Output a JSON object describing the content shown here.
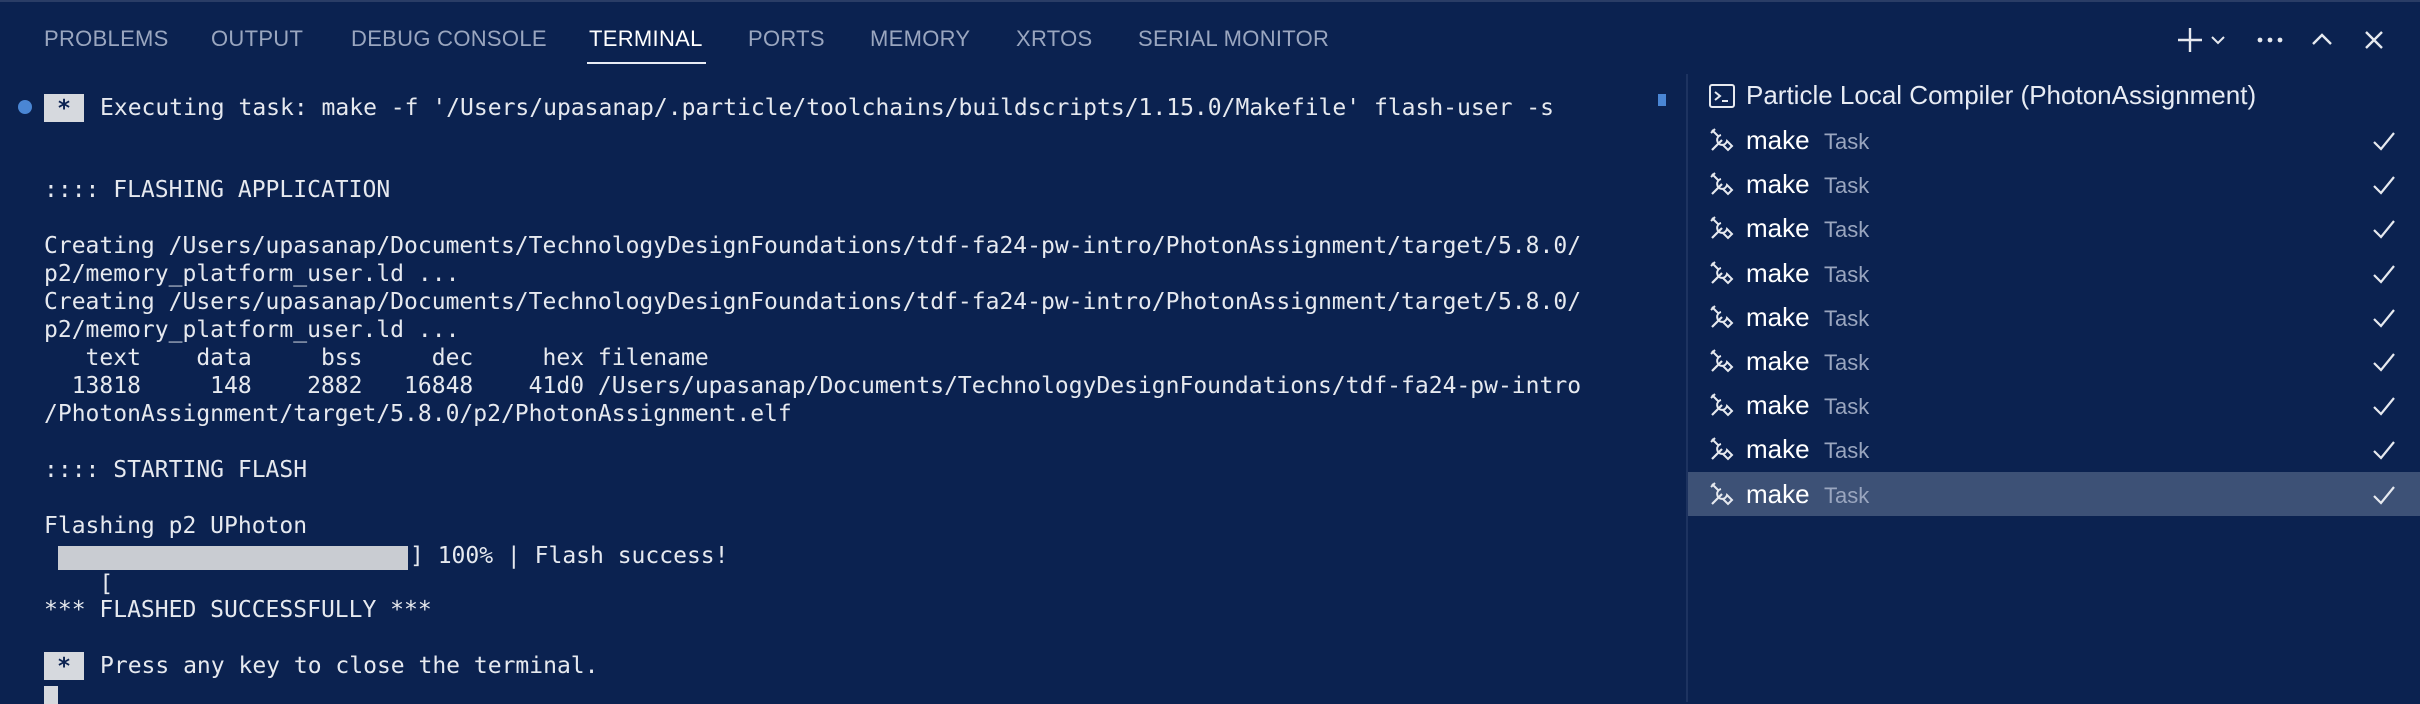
{
  "tabs": [
    {
      "label": "PROBLEMS"
    },
    {
      "label": "OUTPUT"
    },
    {
      "label": "DEBUG CONSOLE"
    },
    {
      "label": "TERMINAL",
      "active": true
    },
    {
      "label": "PORTS"
    },
    {
      "label": "MEMORY"
    },
    {
      "label": "XRTOS"
    },
    {
      "label": "SERIAL MONITOR"
    }
  ],
  "actions": [
    "plus-icon",
    "chevron-down-icon",
    "ellipsis-icon",
    "chevron-up-icon",
    "close-icon"
  ],
  "terminal": {
    "task_star": "*",
    "exec_line": "Executing task: make -f '/Users/upasanap/.particle/toolchains/buildscripts/1.15.0/Makefile' flash-user -s",
    "lines": [
      ":::: FLASHING APPLICATION",
      "Creating /Users/upasanap/Documents/TechnologyDesignFoundations/tdf-fa24-pw-intro/PhotonAssignment/target/5.8.0/",
      "p2/memory_platform_user.ld ...",
      "Creating /Users/upasanap/Documents/TechnologyDesignFoundations/tdf-fa24-pw-intro/PhotonAssignment/target/5.8.0/",
      "p2/memory_platform_user.ld ...",
      "   text    data     bss     dec     hex filename",
      "  13818     148    2882   16848    41d0 /Users/upasanap/Documents/TechnologyDesignFoundations/tdf-fa24-pw-intro",
      "/PhotonAssignment/target/5.8.0/p2/PhotonAssignment.elf",
      ":::: STARTING FLASH",
      "Flashing p2 UPhoton",
      "*** FLASHED SUCCESSFULLY ***"
    ],
    "progress_open": "[",
    "progress_tail": "] 100% | Flash success!",
    "progress_fraction": 1.0,
    "press_star": "*",
    "press_line": "Press any key to close the terminal."
  },
  "task_panel": {
    "header": "Particle Local Compiler (PhotonAssignment)",
    "rows": [
      {
        "name": "make",
        "kind": "Task"
      },
      {
        "name": "make",
        "kind": "Task"
      },
      {
        "name": "make",
        "kind": "Task"
      },
      {
        "name": "make",
        "kind": "Task"
      },
      {
        "name": "make",
        "kind": "Task"
      },
      {
        "name": "make",
        "kind": "Task"
      },
      {
        "name": "make",
        "kind": "Task"
      },
      {
        "name": "make",
        "kind": "Task"
      },
      {
        "name": "make",
        "kind": "Task",
        "selected": true
      }
    ]
  },
  "colors": {
    "background": "#0b2250",
    "accent": "#4a86d4",
    "selected_row": "#3d5176"
  }
}
